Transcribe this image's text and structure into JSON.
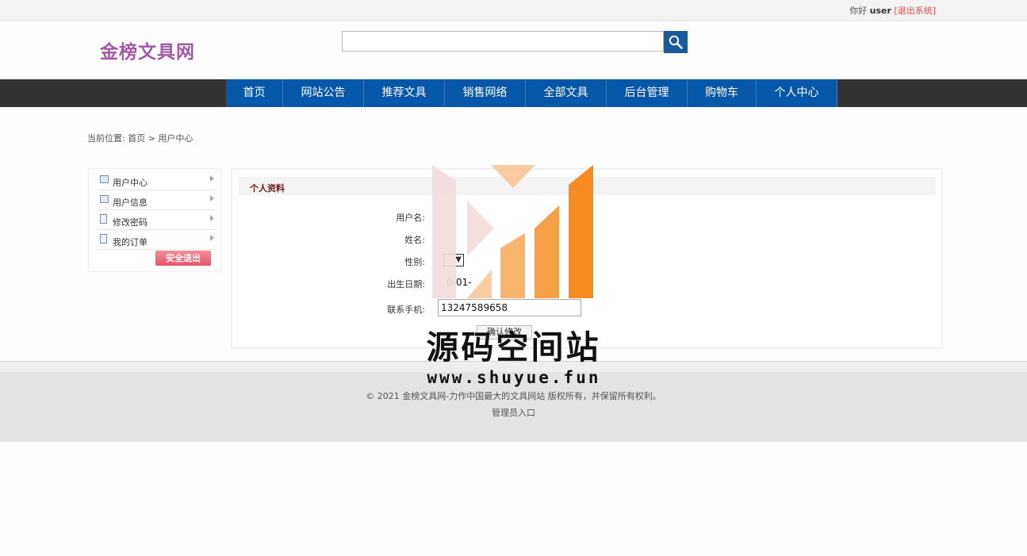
{
  "topbar": {
    "greeting": "你好",
    "username": "user",
    "logout_link": "[退出系统]"
  },
  "header": {
    "logo": "金榜文具网",
    "search": {
      "placeholder": "",
      "value": ""
    },
    "search_icon": "search-icon"
  },
  "nav": {
    "items": [
      "首页",
      "网站公告",
      "推荐文具",
      "销售网络",
      "全部文具",
      "后台管理",
      "购物车",
      "个人中心"
    ]
  },
  "breadcrumb": {
    "prefix": "当前位置:",
    "home": "首页",
    "separator": ">",
    "current": "用户中心"
  },
  "sidebar": {
    "items": [
      {
        "label": "用户中心",
        "icon": "card-icon"
      },
      {
        "label": "用户信息",
        "icon": "card-icon"
      },
      {
        "label": "修改密码",
        "icon": "document-icon"
      },
      {
        "label": "我的订单",
        "icon": "document-icon"
      }
    ],
    "logout_button": "安全退出"
  },
  "profile": {
    "title": "个人资料",
    "fields": {
      "username_label": "用户名:",
      "name_label": "姓名:",
      "gender_label": "性别:",
      "birth_label": "出生日期:",
      "birth_value": "0-01-",
      "phone_label": "联系手机:",
      "phone_value": "13247589658"
    },
    "gender_select_arrow": "▼",
    "submit_label": "确认修改"
  },
  "footer": {
    "copyright": "© 2021 金榜文具网-力作中国最大的文具网站 版权所有，并保留所有权利。",
    "admin_link": "管理员入口"
  },
  "watermark": {
    "title": "源码空间站",
    "url": "www.shuyue.fun"
  },
  "colors": {
    "nav_bg": "#0657a8",
    "nav_bar": "#333333",
    "logo": "#a25aa6",
    "accent_orange": "#f68b1f",
    "logout_pink": "#e8576d"
  }
}
